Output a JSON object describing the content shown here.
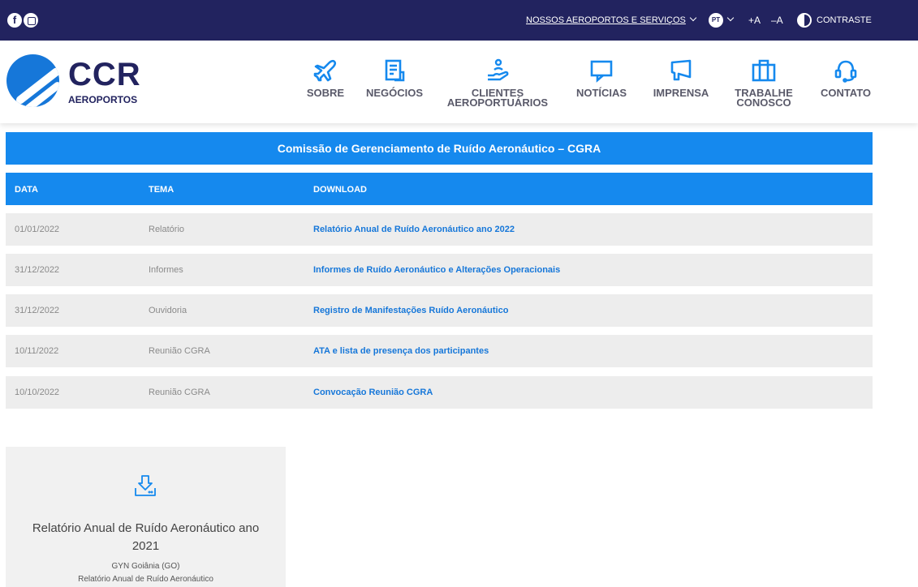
{
  "topbar": {
    "facebook_icon": "facebook-icon",
    "instagram_icon": "instagram-icon",
    "services_label": "NOSSOS AEROPORTOS E SERVIÇOS",
    "lang_label": "PT",
    "increase_font_label": "+A",
    "decrease_font_label": "–A",
    "contrast_label": "CONTRASTE",
    "bg_color": "#22235f"
  },
  "header": {
    "logo_main": "CCR",
    "logo_sub": "AEROPORTOS",
    "nav": [
      {
        "label": "SOBRE",
        "icon": "plane-icon"
      },
      {
        "label": "NEGÓCIOS",
        "icon": "document-chart-icon"
      },
      {
        "label": "CLIENTES\nAEROPORTUÁRIOS",
        "icon": "hand-person-icon"
      },
      {
        "label": "NOTÍCIAS",
        "icon": "monitor-icon"
      },
      {
        "label": "IMPRENSA",
        "icon": "megaphone-icon"
      },
      {
        "label": "TRABALHE\nCONOSCO",
        "icon": "briefcase-icon"
      },
      {
        "label": "CONTATO",
        "icon": "headset-icon"
      }
    ]
  },
  "main": {
    "title": "Comissão de Gerenciamento de Ruído Aeronáutico – CGRA",
    "accent_color": "#1589ee",
    "columns": [
      "DATA",
      "TEMA",
      "DOWNLOAD"
    ],
    "rows": [
      {
        "date": "01/01/2022",
        "tema": "Relatório",
        "download": "Relatório Anual de Ruído Aeronáutico ano 2022"
      },
      {
        "date": "31/12/2022",
        "tema": "Informes",
        "download": "Informes de Ruído Aeronáutico e Alterações Operacionais"
      },
      {
        "date": "31/12/2022",
        "tema": "Ouvidoria",
        "download": "Registro de Manifestações Ruído Aeronáutico"
      },
      {
        "date": "10/11/2022",
        "tema": "Reunião CGRA",
        "download": "ATA e lista de presença dos participantes"
      },
      {
        "date": "10/10/2022",
        "tema": "Reunião CGRA",
        "download": "Convocação Reunião CGRA"
      }
    ]
  },
  "card": {
    "icon": "download-icon",
    "title": "Relatório Anual de Ruído Aeronáutico ano 2021",
    "location": "GYN Goiânia (GO)",
    "description": "Relatório Anual de Ruído Aeronáutico"
  }
}
